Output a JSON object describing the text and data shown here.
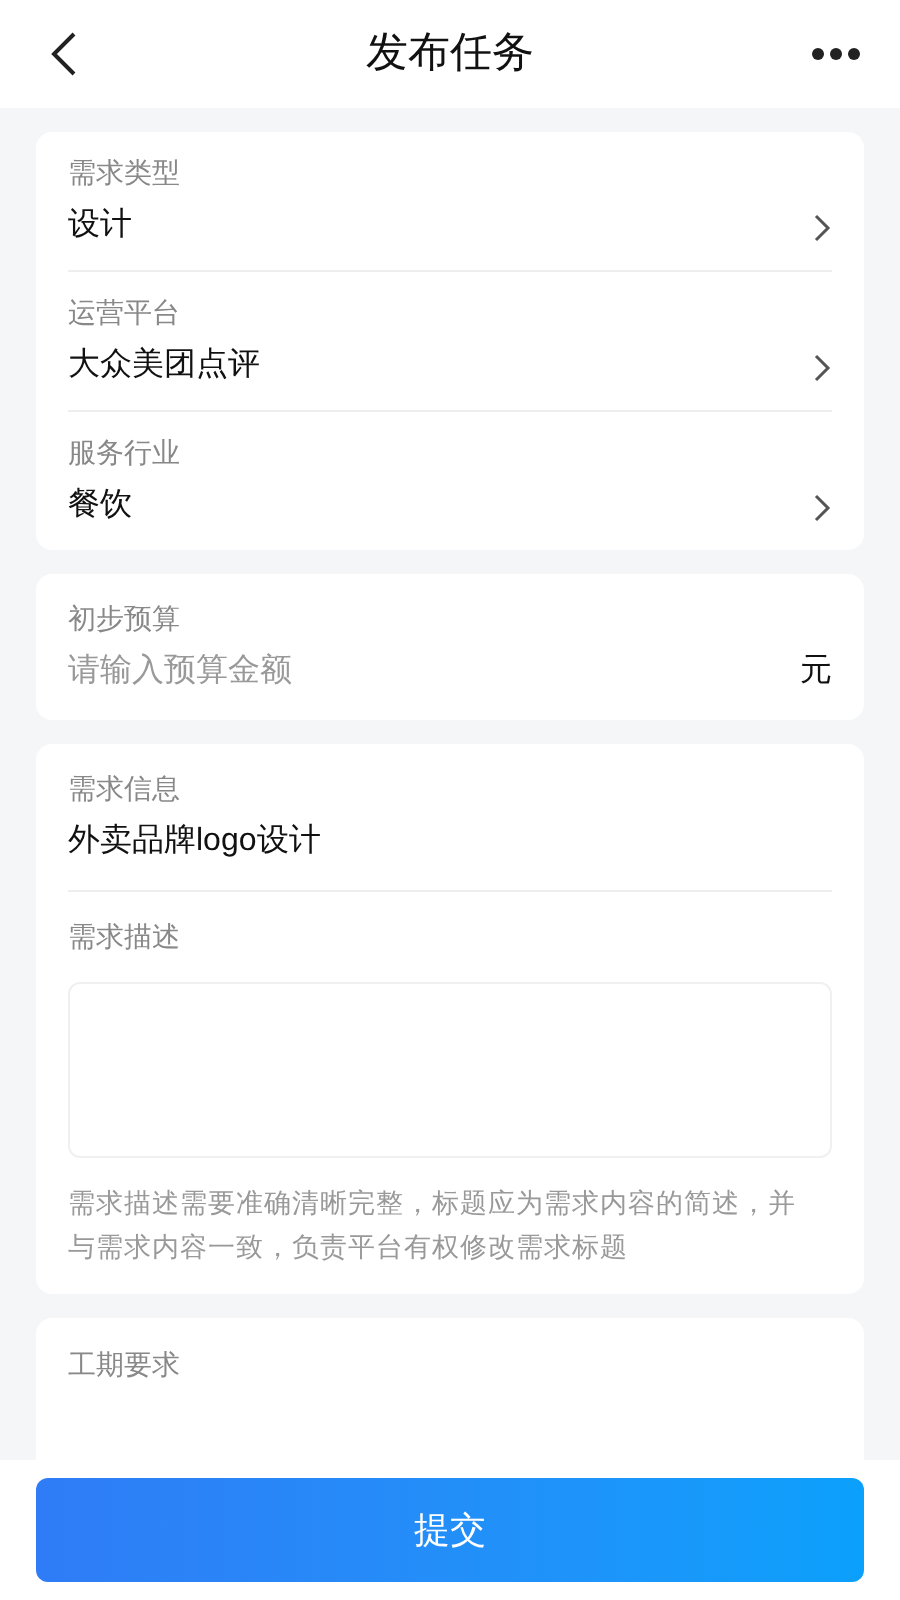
{
  "header": {
    "title": "发布任务"
  },
  "selects": [
    {
      "label": "需求类型",
      "value": "设计"
    },
    {
      "label": "运营平台",
      "value": "大众美团点评"
    },
    {
      "label": "服务行业",
      "value": "餐饮"
    }
  ],
  "budget": {
    "label": "初步预算",
    "placeholder": "请输入预算金额",
    "unit": "元"
  },
  "info": {
    "label": "需求信息",
    "value": "外卖品牌logo设计",
    "description_label": "需求描述",
    "hint": "需求描述需要准确清晰完整，标题应为需求内容的简述，并与需求内容一致，负责平台有权修改需求标题"
  },
  "schedule": {
    "label": "工期要求"
  },
  "submit": "提交"
}
